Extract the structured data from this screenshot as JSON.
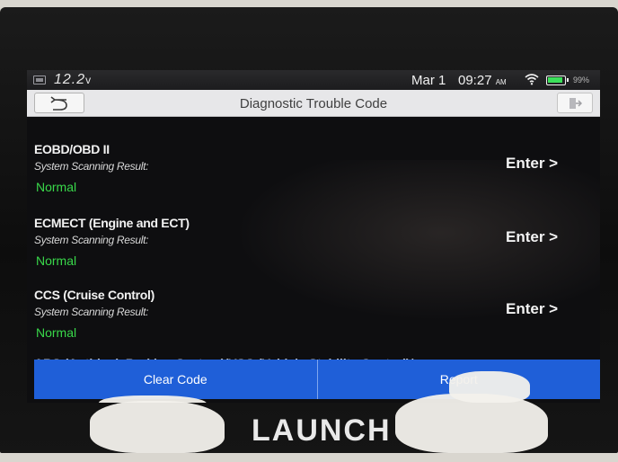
{
  "status_bar": {
    "voltage": "12.2",
    "voltage_unit": "v",
    "date": "Mar 1",
    "time": "09:27",
    "ampm": "AM",
    "battery_percent": "99%"
  },
  "header": {
    "title": "Diagnostic Trouble Code",
    "back_icon": "back-arrow-icon",
    "exit_icon": "exit-icon"
  },
  "systems": [
    {
      "name": "EOBD/OBD II",
      "result_label": "System Scanning Result:",
      "status": "Normal",
      "action": "Enter >"
    },
    {
      "name": "ECMECT (Engine and ECT)",
      "result_label": "System Scanning Result:",
      "status": "Normal",
      "action": "Enter >"
    },
    {
      "name": "CCS (Cruise Control)",
      "result_label": "System Scanning Result:",
      "status": "Normal",
      "action": "Enter >"
    }
  ],
  "partial_item": "ABS (Anti-lock Braking System)/VSC (Vehicle Stability Control)/",
  "actions": {
    "clear_code": "Clear Code",
    "report": "Report"
  },
  "device": {
    "brand": "LAUNCH"
  },
  "colors": {
    "action_bar": "#1f5fd8",
    "status_normal": "#39d84a",
    "battery": "#3be05a"
  }
}
